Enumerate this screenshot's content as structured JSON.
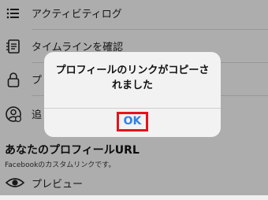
{
  "menu": {
    "items": [
      {
        "label": "アクティビティログ"
      },
      {
        "label": "タイムラインを確認"
      },
      {
        "label": "プ"
      },
      {
        "label": "追"
      }
    ]
  },
  "profile_url_section": {
    "title": "あなたのプロフィールURL",
    "subtitle": "Facebookのカスタムリンクです。",
    "preview_label": "プレビュー"
  },
  "dialog": {
    "message": "プロフィールのリンクがコピーされました",
    "ok_label": "OK"
  },
  "colors": {
    "ok_text": "#2f80ed",
    "highlight_border": "#e3141f"
  }
}
